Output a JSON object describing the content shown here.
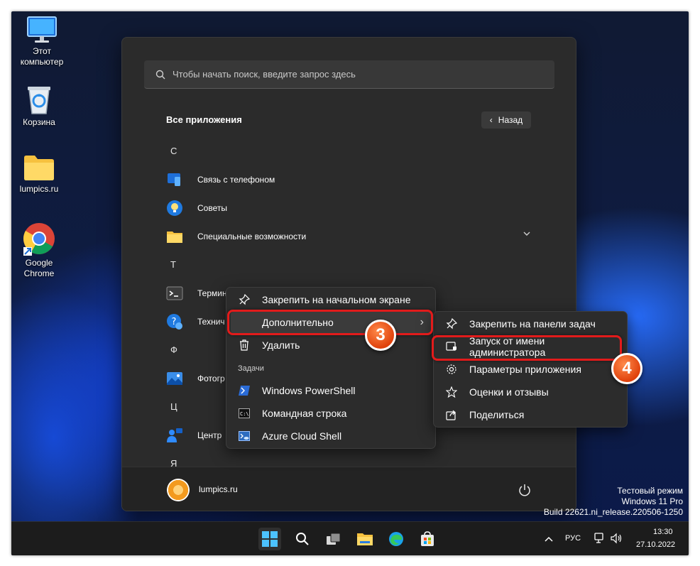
{
  "desktop": {
    "icons": [
      {
        "label_line1": "Этот",
        "label_line2": "компьютер",
        "icon": "monitor-icon"
      },
      {
        "label_line1": "Корзина",
        "icon": "recycle-bin-icon"
      },
      {
        "label_line1": "lumpics.ru",
        "icon": "folder-icon"
      },
      {
        "label_line1": "Google",
        "label_line2": "Chrome",
        "icon": "chrome-icon"
      }
    ]
  },
  "start_menu": {
    "search_placeholder": "Чтобы начать поиск, введите запрос здесь",
    "all_apps_title": "Все приложения",
    "back_label": "Назад",
    "sections": [
      {
        "letter": "С",
        "apps": [
          "Связь с телефоном",
          "Советы",
          "Специальные возможности"
        ]
      },
      {
        "letter": "Т",
        "apps": [
          "Терминал",
          "Технич"
        ]
      },
      {
        "letter": "Ф",
        "apps": [
          "Фотогр"
        ]
      },
      {
        "letter": "Ц",
        "apps": [
          "Центр"
        ]
      },
      {
        "letter": "Я",
        "apps": []
      }
    ],
    "user_name": "lumpics.ru"
  },
  "context_menu": {
    "items": {
      "pin_start": "Закрепить на начальном экране",
      "more": "Дополнительно",
      "uninstall": "Удалить"
    },
    "tasks_header": "Задачи",
    "tasks": [
      "Windows PowerShell",
      "Командная строка",
      "Azure Cloud Shell"
    ]
  },
  "submenu": {
    "items": {
      "pin_taskbar": "Закрепить на панели задач",
      "run_as_admin": "Запуск от имени администратора",
      "app_settings": "Параметры приложения",
      "rate_review": "Оценки и отзывы",
      "share": "Поделиться"
    }
  },
  "annotations": {
    "step3": "3",
    "step4": "4",
    "highlight_color": "#e21b1b"
  },
  "watermark": {
    "line1": "Тестовый режим",
    "line2": "Windows 11 Pro",
    "line3": "Build 22621.ni_release.220506-1250"
  },
  "taskbar": {
    "language": "РУС",
    "time": "13:30",
    "date": "27.10.2022"
  }
}
